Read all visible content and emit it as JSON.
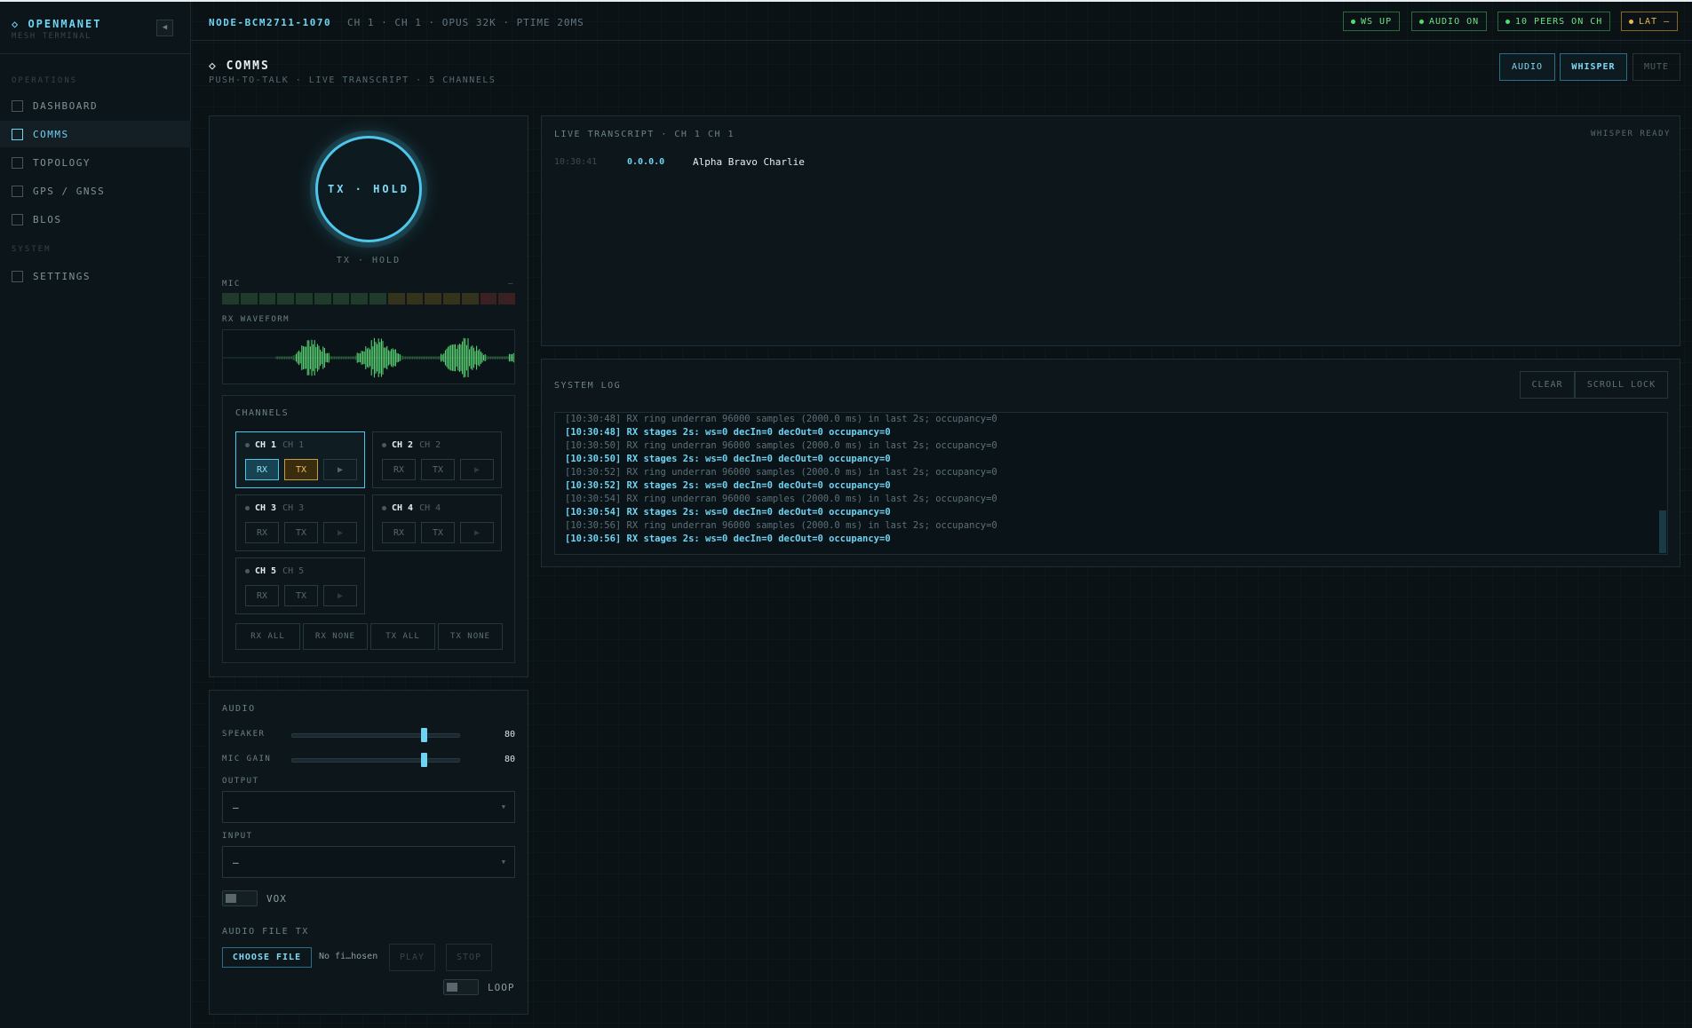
{
  "app": {
    "brand": "◇ OPENMANET",
    "brand_sub": "MESH TERMINAL",
    "collapse_glyph": "◀"
  },
  "sidebar": {
    "operations_label": "OPERATIONS",
    "system_label": "SYSTEM",
    "items": [
      {
        "label": "DASHBOARD"
      },
      {
        "label": "COMMS",
        "active": true
      },
      {
        "label": "TOPOLOGY"
      },
      {
        "label": "GPS / GNSS"
      },
      {
        "label": "BLOS"
      },
      {
        "label": "SETTINGS"
      }
    ]
  },
  "header": {
    "node_id": "NODE-BCM2711-1070",
    "node_meta": "CH 1 · CH 1 · OPUS 32K · PTIME 20MS",
    "pills": [
      {
        "label": "WS UP",
        "status": "ok"
      },
      {
        "label": "AUDIO ON",
        "status": "ok"
      },
      {
        "label": "10 PEERS ON CH",
        "status": "ok"
      },
      {
        "label": "LAT —",
        "status": "warn"
      }
    ]
  },
  "page": {
    "title": "◇ COMMS",
    "subtitle": "PUSH-TO-TALK · LIVE TRANSCRIPT · 5 CHANNELS",
    "buttons": {
      "audio": "AUDIO",
      "whisper": "WHISPER",
      "mute": "MUTE"
    }
  },
  "ptt": {
    "button_label": "TX · HOLD",
    "status_label": "TX · HOLD",
    "mic_label": "MIC",
    "mic_value": "—",
    "waveform_label": "RX WAVEFORM"
  },
  "channels": {
    "label": "CHANNELS",
    "items": [
      {
        "name": "CH 1",
        "sub": "CH 1",
        "rx": "RX",
        "tx": "TX",
        "play": "▶",
        "selected": true,
        "rx_on": true,
        "tx_on": true
      },
      {
        "name": "CH 2",
        "sub": "CH 2",
        "rx": "RX",
        "tx": "TX",
        "play": "▶"
      },
      {
        "name": "CH 3",
        "sub": "CH 3",
        "rx": "RX",
        "tx": "TX",
        "play": "▶"
      },
      {
        "name": "CH 4",
        "sub": "CH 4",
        "rx": "RX",
        "tx": "TX",
        "play": "▶"
      },
      {
        "name": "CH 5",
        "sub": "CH 5",
        "rx": "RX",
        "tx": "TX",
        "play": "▶"
      }
    ],
    "bulk": {
      "rx_all": "RX ALL",
      "rx_none": "RX NONE",
      "tx_all": "TX ALL",
      "tx_none": "TX NONE"
    }
  },
  "audio": {
    "label": "AUDIO",
    "speaker_label": "SPEAKER",
    "speaker_value": "80",
    "mic_gain_label": "MIC GAIN",
    "mic_gain_value": "80",
    "output_label": "OUTPUT",
    "output_value": "—",
    "input_label": "INPUT",
    "input_value": "—",
    "vox_label": "VOX",
    "file_tx_label": "AUDIO FILE TX",
    "choose_file": "CHOOSE FILE",
    "file_name": "No fi…hosen",
    "play": "PLAY",
    "stop": "STOP",
    "loop_label": "LOOP"
  },
  "transcript": {
    "title": "LIVE TRANSCRIPT · CH 1 CH 1",
    "status": "WHISPER READY",
    "entries": [
      {
        "time": "10:30:41",
        "source": "0.0.0.0",
        "text": "Alpha Bravo Charlie"
      }
    ]
  },
  "syslog": {
    "title": "SYSTEM LOG",
    "clear": "CLEAR",
    "scroll_lock": "SCROLL LOCK",
    "lines": [
      {
        "text": "[10:30:48] RX ring underran 96000 samples (2000.0 ms) in last 2s; occupancy=0",
        "kind": "g"
      },
      {
        "text": "[10:30:48] RX stages 2s: ws=0 decIn=0 decOut=0 occupancy=0",
        "kind": "c"
      },
      {
        "text": "[10:30:50] RX ring underran 96000 samples (2000.0 ms) in last 2s; occupancy=0",
        "kind": "g"
      },
      {
        "text": "[10:30:50] RX stages 2s: ws=0 decIn=0 decOut=0 occupancy=0",
        "kind": "c"
      },
      {
        "text": "[10:30:52] RX ring underran 96000 samples (2000.0 ms) in last 2s; occupancy=0",
        "kind": "g"
      },
      {
        "text": "[10:30:52] RX stages 2s: ws=0 decIn=0 decOut=0 occupancy=0",
        "kind": "c"
      },
      {
        "text": "[10:30:54] RX ring underran 96000 samples (2000.0 ms) in last 2s; occupancy=0",
        "kind": "g"
      },
      {
        "text": "[10:30:54] RX stages 2s: ws=0 decIn=0 decOut=0 occupancy=0",
        "kind": "c"
      },
      {
        "text": "[10:30:56] RX ring underran 96000 samples (2000.0 ms) in last 2s; occupancy=0",
        "kind": "g"
      },
      {
        "text": "[10:30:56] RX stages 2s: ws=0 decIn=0 decOut=0 occupancy=0",
        "kind": "c"
      }
    ]
  },
  "colors": {
    "accent": "#6fd3f2",
    "ok": "#4ee06c",
    "warn": "#f0b64c",
    "bg": "#0b1216"
  }
}
